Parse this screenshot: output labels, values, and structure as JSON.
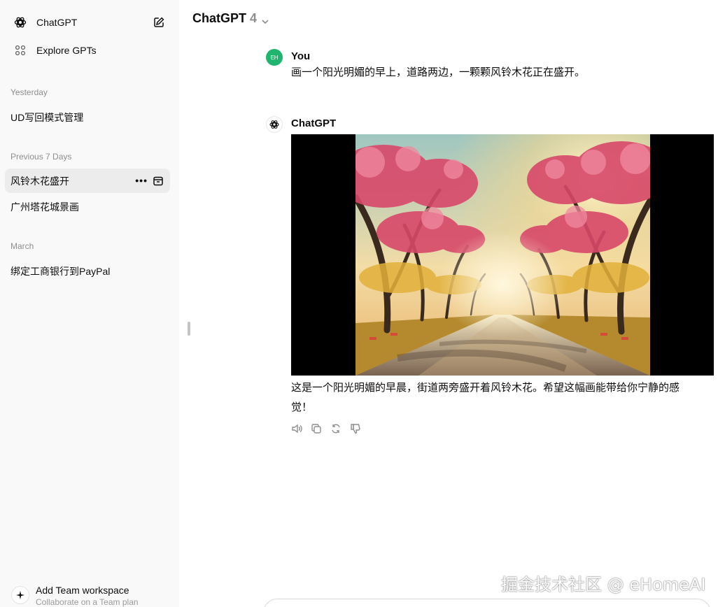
{
  "sidebar": {
    "brand": "ChatGPT",
    "explore": "Explore GPTs",
    "sections": [
      {
        "label": "Yesterday",
        "chats": [
          "UD写回模式管理"
        ]
      },
      {
        "label": "Previous 7 Days",
        "chats": [
          "风铃木花盛开",
          "广州塔花城景画"
        ]
      },
      {
        "label": "March",
        "chats": [
          "绑定工商银行到PayPal"
        ]
      }
    ],
    "team": {
      "title": "Add Team workspace",
      "subtitle": "Collaborate on a Team plan"
    }
  },
  "header": {
    "model": "ChatGPT",
    "version": "4"
  },
  "conversation": {
    "user": {
      "avatar_initials": "EH",
      "name": "You",
      "text": "画一个阳光明媚的早上，道路两边，一颗颗风铃木花正在盛开。"
    },
    "assistant": {
      "name": "ChatGPT",
      "text_line1": "这是一个阳光明媚的早晨，街道两旁盛开着风铃木花。希望这幅画能带给你宁静的感",
      "text_line2": "觉！",
      "actions": [
        "speaker-icon",
        "copy-icon",
        "regenerate-icon",
        "thumbs-down-icon"
      ]
    }
  },
  "watermark": "掘金技术社区 @ eHomeAI",
  "colors": {
    "sidebar_bg": "#f9f9f9",
    "active_chat_bg": "#ececec",
    "user_avatar": "#1fb56e"
  }
}
